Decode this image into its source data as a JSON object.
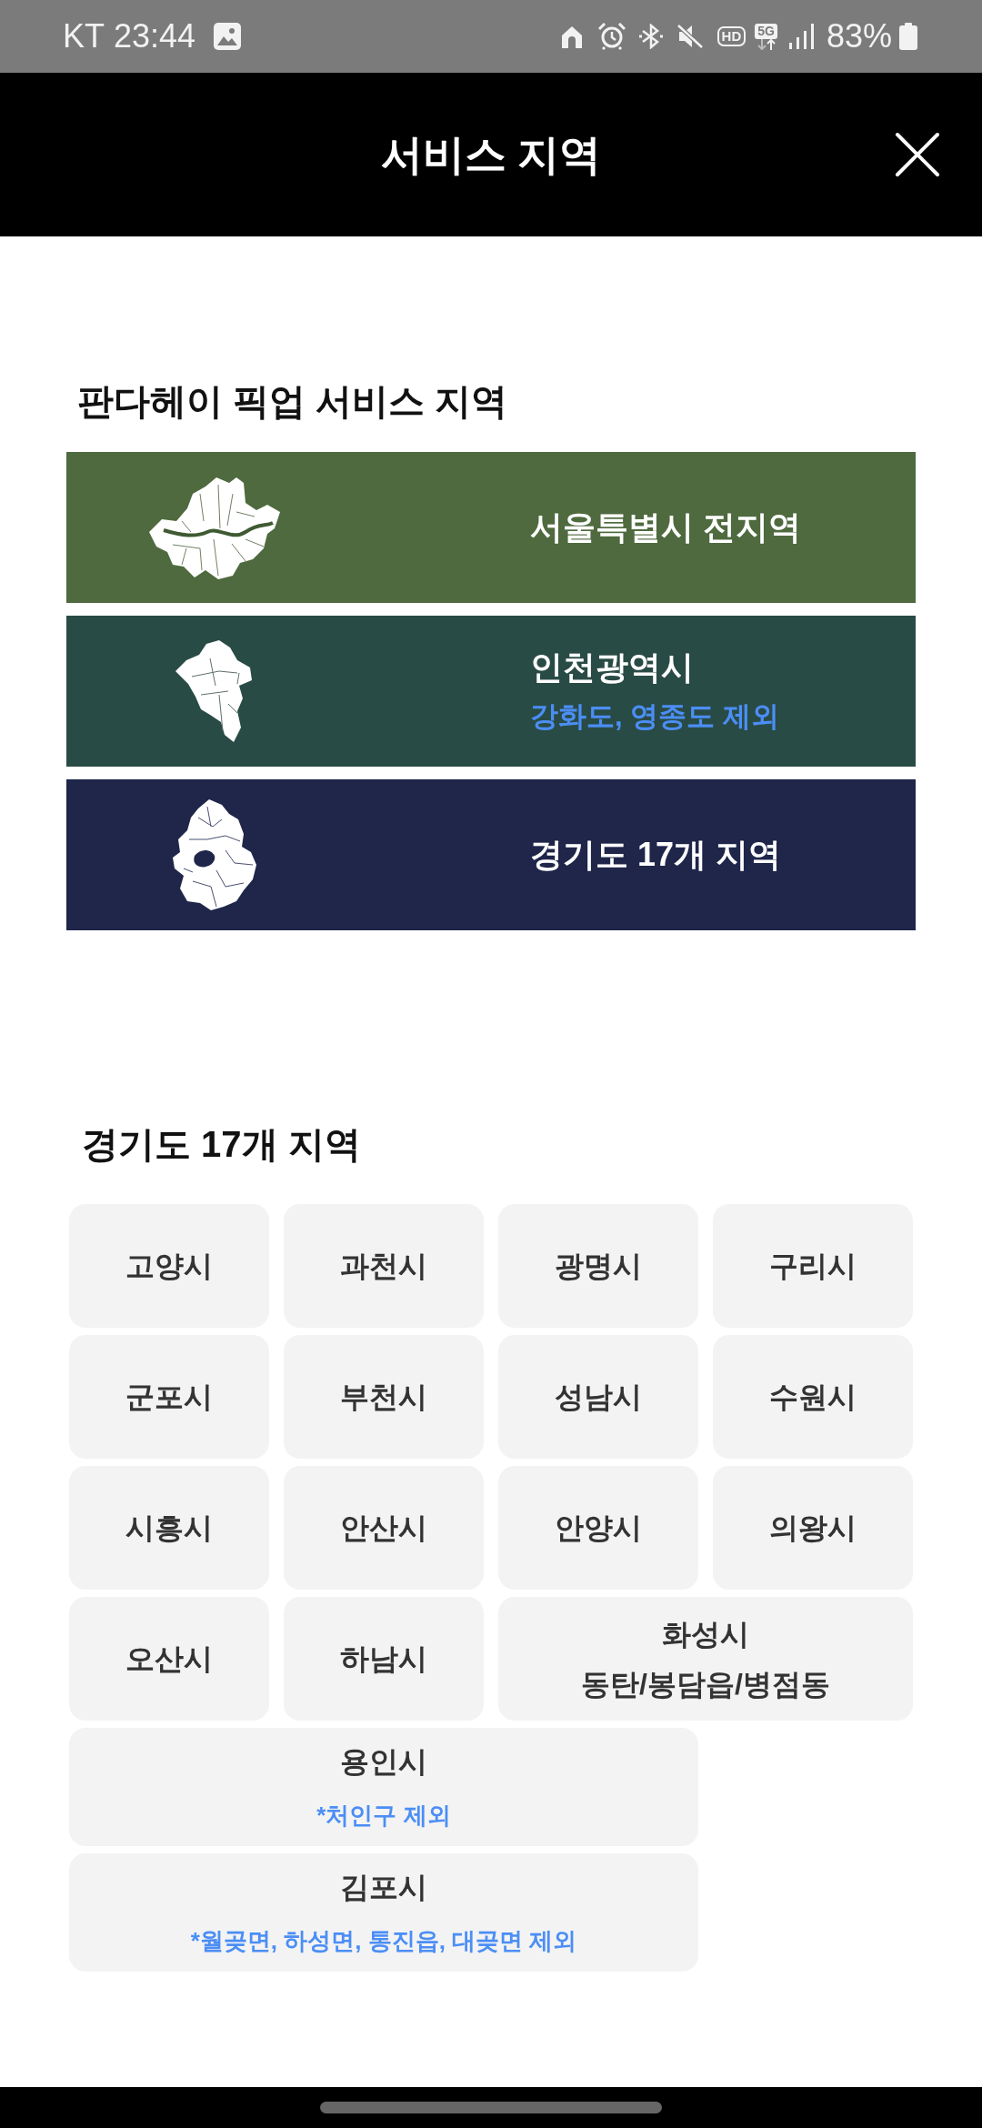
{
  "status_bar": {
    "carrier": "KT",
    "time": "23:44",
    "hd_label": "HD",
    "network": "5G",
    "battery": "83%"
  },
  "header": {
    "title": "서비스 지역"
  },
  "pickup_section": {
    "title": "판다헤이 픽업 서비스 지역",
    "regions": [
      {
        "name": "서울특별시 전지역",
        "color": "#4e6a3e"
      },
      {
        "name": "인천광역시",
        "note": "강화도, 영종도 제외",
        "color": "#294b45"
      },
      {
        "name": "경기도 17개 지역",
        "color": "#1f264a"
      }
    ]
  },
  "gyeonggi_section": {
    "title": "경기도 17개 지역",
    "cities": [
      {
        "kind": "city",
        "name": "고양시"
      },
      {
        "kind": "city",
        "name": "과천시"
      },
      {
        "kind": "city",
        "name": "광명시"
      },
      {
        "kind": "city",
        "name": "구리시"
      },
      {
        "kind": "city",
        "name": "군포시"
      },
      {
        "kind": "city",
        "name": "부천시"
      },
      {
        "kind": "city",
        "name": "성남시"
      },
      {
        "kind": "city",
        "name": "수원시"
      },
      {
        "kind": "city",
        "name": "시흥시"
      },
      {
        "kind": "city",
        "name": "안산시"
      },
      {
        "kind": "city",
        "name": "안양시"
      },
      {
        "kind": "city",
        "name": "의왕시"
      },
      {
        "kind": "city",
        "name": "오산시"
      },
      {
        "kind": "city",
        "name": "하남시"
      },
      {
        "kind": "city_area",
        "name": "화성시",
        "area": "동탄/봉담읍/병점동"
      },
      {
        "kind": "city_exclusion",
        "name": "용인시",
        "note": "*처인구 제외"
      },
      {
        "kind": "city_exclusion",
        "name": "김포시",
        "note": "*월곶면, 하성면, 통진읍, 대곶면 제외"
      }
    ]
  }
}
